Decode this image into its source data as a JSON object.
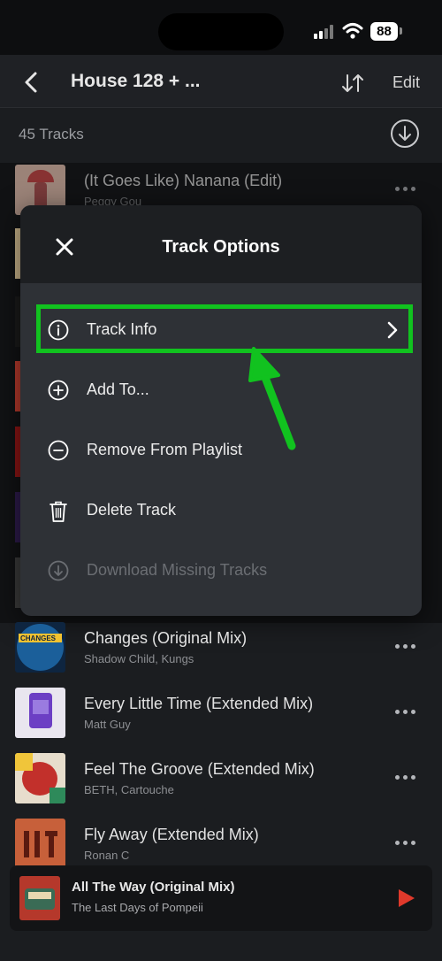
{
  "status_bar": {
    "battery": "88"
  },
  "nav": {
    "title": "House 128 + ...",
    "edit_label": "Edit"
  },
  "playlist": {
    "track_count": "45 Tracks"
  },
  "tracks": [
    {
      "title": "(It Goes Like) Nanana (Edit)",
      "artist": "Peggy Gou"
    },
    {
      "title": "Changes (Original Mix)",
      "artist": "Shadow Child, Kungs"
    },
    {
      "title": "Every Little Time (Extended Mix)",
      "artist": "Matt Guy"
    },
    {
      "title": "Feel The Groove (Extended Mix)",
      "artist": "BETH, Cartouche"
    },
    {
      "title": "Fly Away (Extended Mix)",
      "artist": "Ronan C"
    }
  ],
  "track_options": {
    "title": "Track Options",
    "items": [
      {
        "label": "Track Info",
        "icon": "info-icon",
        "enabled": true
      },
      {
        "label": "Add To...",
        "icon": "plus-circle-icon",
        "enabled": true
      },
      {
        "label": "Remove From Playlist",
        "icon": "minus-circle-icon",
        "enabled": true
      },
      {
        "label": "Delete Track",
        "icon": "trash-icon",
        "enabled": true
      },
      {
        "label": "Download Missing Tracks",
        "icon": "download-circle-icon",
        "enabled": false
      }
    ]
  },
  "mini_player": {
    "title": "All The Way (Original Mix)",
    "artist": "The Last Days of Pompeii"
  },
  "colors": {
    "highlight": "#11c21f",
    "play_accent": "#e0392b",
    "background": "#1b1d20"
  }
}
